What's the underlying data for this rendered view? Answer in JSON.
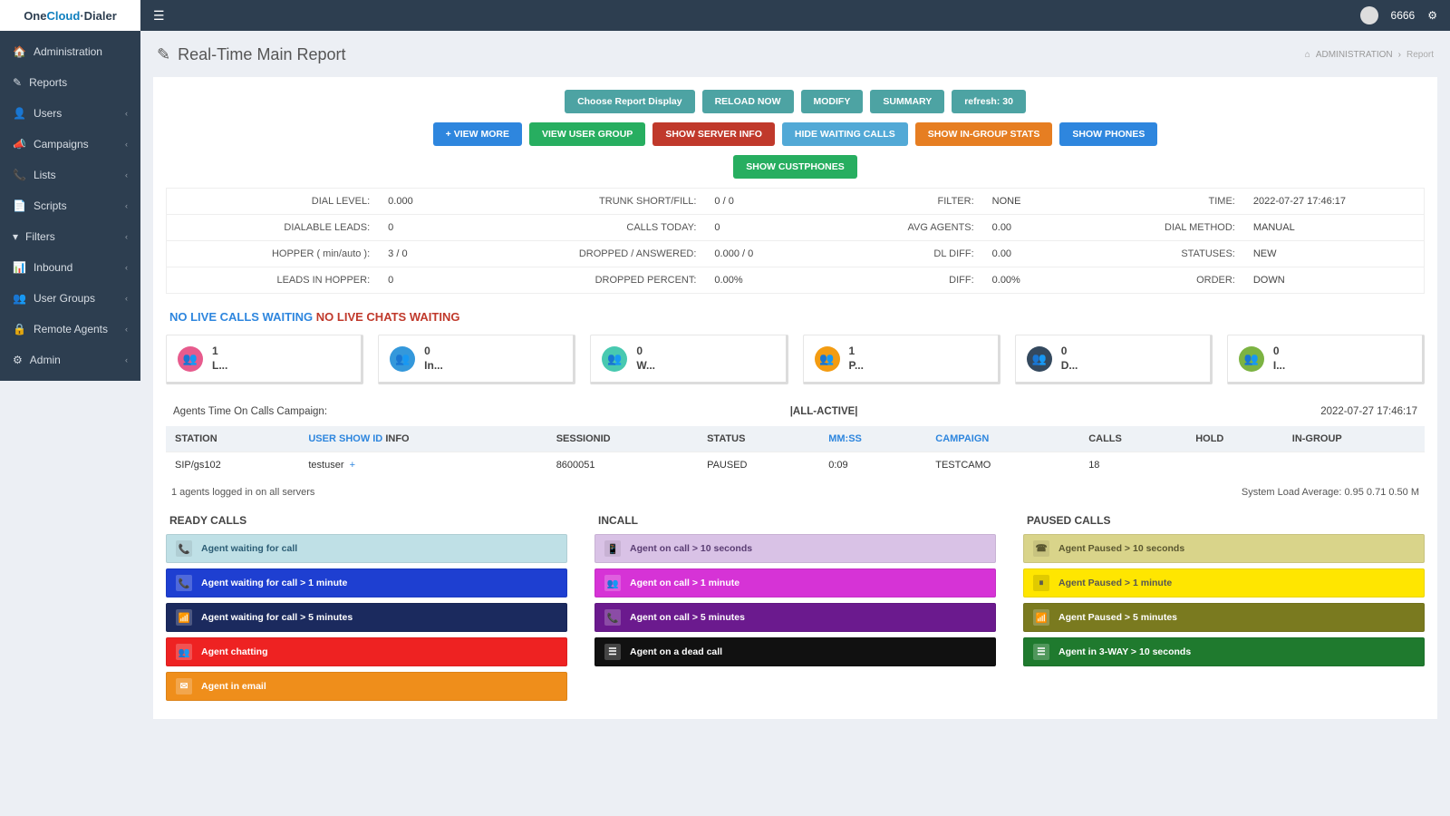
{
  "brand": {
    "one": "One",
    "cloud": "Cloud",
    "dialer": "Dialer"
  },
  "user": {
    "id": "6666"
  },
  "nav": {
    "items": [
      {
        "label": "Administration",
        "icon": "dashboard-icon",
        "chev": false
      },
      {
        "label": "Reports",
        "icon": "edit-icon",
        "chev": false
      },
      {
        "label": "Users",
        "icon": "user-icon",
        "chev": true
      },
      {
        "label": "Campaigns",
        "icon": "bullhorn-icon",
        "chev": true
      },
      {
        "label": "Lists",
        "icon": "phone-icon",
        "chev": true
      },
      {
        "label": "Scripts",
        "icon": "file-icon",
        "chev": true
      },
      {
        "label": "Filters",
        "icon": "filter-icon",
        "chev": true
      },
      {
        "label": "Inbound",
        "icon": "chart-icon",
        "chev": true
      },
      {
        "label": "User Groups",
        "icon": "users-icon",
        "chev": true
      },
      {
        "label": "Remote Agents",
        "icon": "lock-icon",
        "chev": true
      },
      {
        "label": "Admin",
        "icon": "gear-icon",
        "chev": true
      }
    ]
  },
  "page": {
    "title": "Real-Time Main Report",
    "crumb1": "ADMINISTRATION",
    "crumb2": "Report"
  },
  "buttons": {
    "row1": [
      {
        "label": "Choose Report Display",
        "cls": "btn-teal"
      },
      {
        "label": "RELOAD NOW",
        "cls": "btn-teal"
      },
      {
        "label": "MODIFY",
        "cls": "btn-teal"
      },
      {
        "label": "SUMMARY",
        "cls": "btn-teal"
      },
      {
        "label": "refresh: 30",
        "cls": "btn-teal"
      }
    ],
    "row2": [
      {
        "label": "+ VIEW MORE",
        "cls": "btn-blue"
      },
      {
        "label": "VIEW USER GROUP",
        "cls": "btn-green"
      },
      {
        "label": "SHOW SERVER INFO",
        "cls": "btn-red"
      },
      {
        "label": "HIDE WAITING CALLS",
        "cls": "btn-sky"
      },
      {
        "label": "SHOW IN-GROUP STATS",
        "cls": "btn-orange"
      },
      {
        "label": "SHOW PHONES",
        "cls": "btn-blue"
      }
    ],
    "row3": [
      {
        "label": "SHOW CUSTPHONES",
        "cls": "btn-green"
      }
    ]
  },
  "kv": [
    {
      "l1": "DIAL LEVEL:",
      "v1": "0.000",
      "l2": "TRUNK SHORT/FILL:",
      "v2": "0 / 0",
      "l3": "FILTER:",
      "v3": "NONE",
      "l4": "TIME:",
      "v4": "2022-07-27 17:46:17"
    },
    {
      "l1": "DIALABLE LEADS:",
      "v1": "0",
      "l2": "CALLS TODAY:",
      "v2": "0",
      "l3": "AVG AGENTS:",
      "v3": "0.00",
      "l4": "DIAL METHOD:",
      "v4": "MANUAL"
    },
    {
      "l1": "HOPPER ( min/auto ):",
      "v1": "3 / 0",
      "l2": "DROPPED / ANSWERED:",
      "v2": "0.000 / 0",
      "l3": "DL DIFF:",
      "v3": "0.00",
      "l4": "STATUSES:",
      "v4": "NEW"
    },
    {
      "l1": "LEADS IN HOPPER:",
      "v1": "0",
      "l2": "DROPPED PERCENT:",
      "v2": "0.00%",
      "l3": "DIFF:",
      "v3": "0.00%",
      "l4": "ORDER:",
      "v4": "DOWN"
    }
  ],
  "status": {
    "calls": "NO LIVE CALLS WAITING",
    "chats": "NO LIVE CHATS WAITING"
  },
  "drop": "",
  "tiles": [
    {
      "n": "1",
      "label": "L...",
      "cls": "ico-pink"
    },
    {
      "n": "0",
      "label": "In...",
      "cls": "ico-blue"
    },
    {
      "n": "0",
      "label": "W...",
      "cls": "ico-teal"
    },
    {
      "n": "1",
      "label": "P...",
      "cls": "ico-orange"
    },
    {
      "n": "0",
      "label": "D...",
      "cls": "ico-dark"
    },
    {
      "n": "0",
      "label": "I...",
      "cls": "ico-green"
    }
  ],
  "campaign_line": {
    "left": "Agents Time On Calls Campaign:",
    "mid": "|ALL-ACTIVE|",
    "right": "2022-07-27 17:46:17"
  },
  "agent_table": {
    "headers": [
      "STATION",
      "SESSIONID",
      "STATUS",
      "CALLS",
      "HOLD",
      "IN-GROUP"
    ],
    "user_col": {
      "link": "USER SHOW ID",
      "tail": " INFO"
    },
    "mmss": "MM:SS",
    "campaign": "CAMPAIGN",
    "rows": [
      {
        "station": "SIP/gs102",
        "user": "testuser",
        "plus": "+",
        "session": "8600051",
        "status": "PAUSED",
        "mmss": "0:09",
        "campaign": "TESTCAMO",
        "calls": "18",
        "hold": "",
        "ingroup": ""
      }
    ]
  },
  "foot": {
    "left": "1 agents logged in on all servers",
    "right": "System Load Average: 0.95 0.71 0.50   M"
  },
  "legends": {
    "ready": {
      "title": "READY CALLS",
      "rows": [
        {
          "label": "Agent waiting for call",
          "cls": "li-lt",
          "icon": "phone-icon"
        },
        {
          "label": "Agent waiting for call > 1 minute",
          "cls": "li-blue",
          "icon": "phone-icon"
        },
        {
          "label": "Agent waiting for call > 5 minutes",
          "cls": "li-navy",
          "icon": "phone-wave-icon"
        },
        {
          "label": "Agent chatting",
          "cls": "li-red",
          "icon": "users-icon"
        },
        {
          "label": "Agent in email",
          "cls": "li-orange",
          "icon": "envelope-icon"
        }
      ]
    },
    "incall": {
      "title": "INCALL",
      "rows": [
        {
          "label": "Agent on call > 10 seconds",
          "cls": "li-lav",
          "icon": "mobile-icon"
        },
        {
          "label": "Agent on call > 1 minute",
          "cls": "li-mag",
          "icon": "users-icon"
        },
        {
          "label": "Agent on call > 5 minutes",
          "cls": "li-pur",
          "icon": "phone-icon"
        },
        {
          "label": "Agent on a dead call",
          "cls": "li-black",
          "icon": "list-icon"
        }
      ]
    },
    "paused": {
      "title": "PAUSED CALLS",
      "rows": [
        {
          "label": "Agent Paused > 10 seconds",
          "cls": "li-kha",
          "icon": "phone-square-icon"
        },
        {
          "label": "Agent Paused > 1 minute",
          "cls": "li-yel",
          "icon": "pause-icon"
        },
        {
          "label": "Agent Paused > 5 minutes",
          "cls": "li-olive",
          "icon": "phone-wave-icon"
        },
        {
          "label": "Agent in 3-WAY > 10 seconds",
          "cls": "li-green",
          "icon": "list-icon"
        }
      ]
    }
  }
}
